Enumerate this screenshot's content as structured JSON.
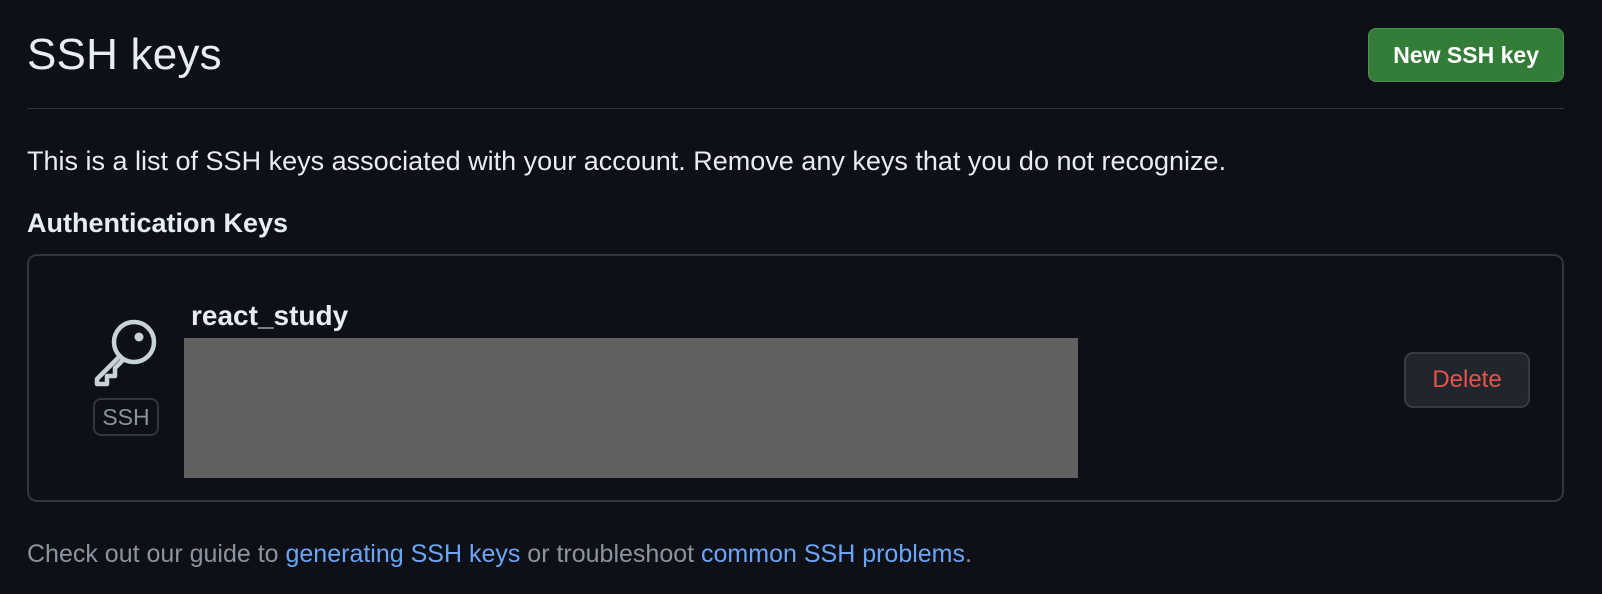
{
  "header": {
    "title": "SSH keys",
    "new_key_button": "New SSH key"
  },
  "intro_text": "This is a list of SSH keys associated with your account. Remove any keys that you do not recognize.",
  "section_title": "Authentication Keys",
  "keys": [
    {
      "title": "react_study",
      "type_badge": "SSH",
      "icon": "key-icon",
      "delete_label": "Delete"
    }
  ],
  "footer": {
    "prefix": "Check out our guide to ",
    "link1": "generating SSH keys",
    "middle": " or troubleshoot ",
    "link2": "common SSH problems",
    "suffix": "."
  },
  "colors": {
    "background": "#0d1117",
    "primary_button": "#347d39",
    "danger_text": "#e5534b",
    "link": "#6ca4f8",
    "border": "#30363d",
    "redacted_block": "#616161"
  }
}
